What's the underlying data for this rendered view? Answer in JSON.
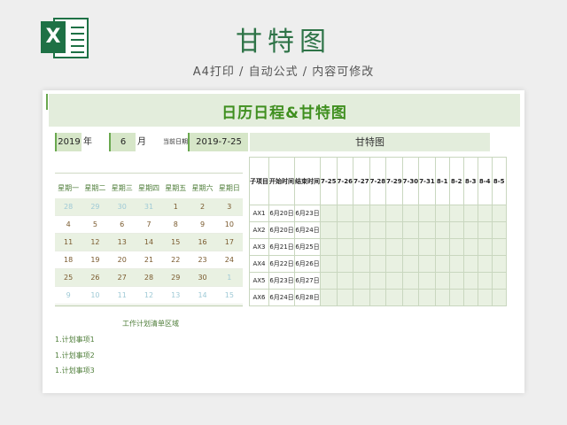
{
  "header": {
    "title": "甘特图",
    "subtitle": "A4打印 / 自动公式 / 内容可修改",
    "icon_letter": "X",
    "accent": "#1e7145"
  },
  "sheet": {
    "banner_title": "日历日程&甘特图",
    "year_value": "2019",
    "year_label": "年",
    "month_value": "6",
    "month_label": "月",
    "date_label": "当前日期:",
    "date_value": "2019-7-25",
    "gantt_title": "甘特图"
  },
  "calendar": {
    "weekdays": [
      "星期一",
      "星期二",
      "星期三",
      "星期四",
      "星期五",
      "星期六",
      "星期日"
    ],
    "weeks": [
      [
        {
          "d": "28",
          "o": true
        },
        {
          "d": "29",
          "o": true
        },
        {
          "d": "30",
          "o": true
        },
        {
          "d": "31",
          "o": true
        },
        {
          "d": "1"
        },
        {
          "d": "2"
        },
        {
          "d": "3"
        }
      ],
      [
        {
          "d": "4"
        },
        {
          "d": "5"
        },
        {
          "d": "6"
        },
        {
          "d": "7"
        },
        {
          "d": "8"
        },
        {
          "d": "9"
        },
        {
          "d": "10"
        }
      ],
      [
        {
          "d": "11"
        },
        {
          "d": "12"
        },
        {
          "d": "13"
        },
        {
          "d": "14"
        },
        {
          "d": "15"
        },
        {
          "d": "16"
        },
        {
          "d": "17"
        }
      ],
      [
        {
          "d": "18"
        },
        {
          "d": "19"
        },
        {
          "d": "20"
        },
        {
          "d": "21"
        },
        {
          "d": "22"
        },
        {
          "d": "23"
        },
        {
          "d": "24"
        }
      ],
      [
        {
          "d": "25"
        },
        {
          "d": "26"
        },
        {
          "d": "27"
        },
        {
          "d": "28"
        },
        {
          "d": "29"
        },
        {
          "d": "30"
        },
        {
          "d": "1",
          "o": true
        }
      ],
      [
        {
          "d": "9",
          "o": true
        },
        {
          "d": "10",
          "o": true
        },
        {
          "d": "11",
          "o": true
        },
        {
          "d": "12",
          "o": true
        },
        {
          "d": "13",
          "o": true
        },
        {
          "d": "14",
          "o": true
        },
        {
          "d": "15",
          "o": true
        }
      ]
    ]
  },
  "plan": {
    "title": "工作计划清单区域",
    "items": [
      "1.计划事项1",
      "1.计划事项2",
      "1.计划事项3"
    ]
  },
  "gantt": {
    "headers": [
      "子项目",
      "开始时间",
      "结束时间",
      "7-25",
      "7-26",
      "7-27",
      "7-28",
      "7-29",
      "7-30",
      "7-31",
      "8-1",
      "8-2",
      "8-3",
      "8-4",
      "8-5"
    ],
    "rows": [
      [
        "AX1",
        "6月20日",
        "6月23日"
      ],
      [
        "AX2",
        "6月20日",
        "6月24日"
      ],
      [
        "AX3",
        "6月21日",
        "6月25日"
      ],
      [
        "AX4",
        "6月22日",
        "6月26日"
      ],
      [
        "AX5",
        "6月23日",
        "6月27日"
      ],
      [
        "AX6",
        "6月24日",
        "6月28日"
      ]
    ]
  }
}
